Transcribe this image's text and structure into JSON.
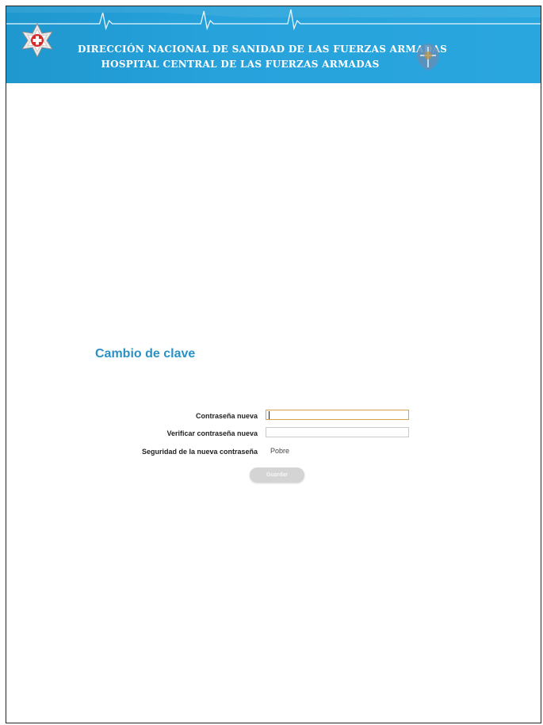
{
  "header": {
    "title_line1": "DIRECCIÓN NACIONAL DE SANIDAD DE LAS FUERZAS ARMADAS",
    "title_line2": "HOSPITAL CENTRAL DE LAS FUERZAS ARMADAS",
    "left_logo_icon": "star-red-cross-icon",
    "right_logo_icon": "emblem-icon",
    "background_color": "#27a2db"
  },
  "page": {
    "title": "Cambio de clave"
  },
  "form": {
    "new_password_label": "Contraseña nueva",
    "new_password_value": "",
    "verify_password_label": "Verificar contraseña nueva",
    "verify_password_value": "",
    "strength_label": "Seguridad de la nueva contraseña",
    "strength_value": "Pobre",
    "save_label": "Guardar"
  }
}
